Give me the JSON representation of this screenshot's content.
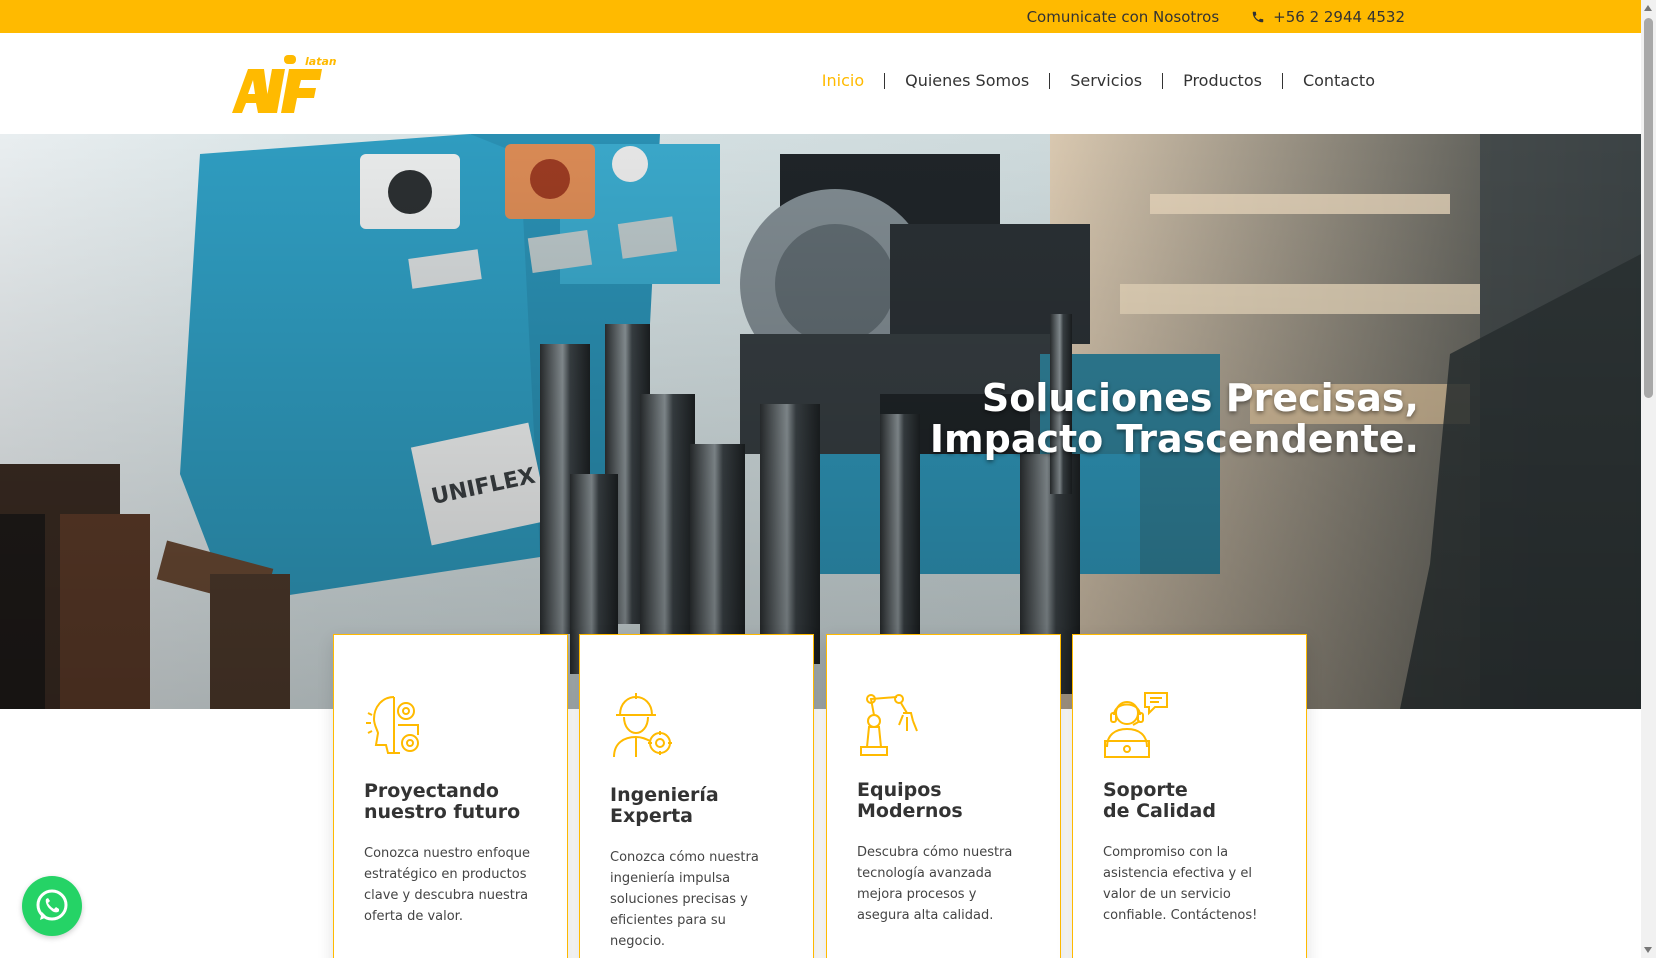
{
  "topbar": {
    "contact_text": "Comunicate con Nosotros",
    "phone": "+56 2 2944 4532",
    "phone_icon": "phone-icon",
    "background": "#ffba00"
  },
  "logo": {
    "text": "AIF",
    "suffix": "latam",
    "color": "#ffba00"
  },
  "nav": {
    "items": [
      {
        "label": "Inicio",
        "active": true
      },
      {
        "label": "Quienes Somos",
        "active": false
      },
      {
        "label": "Servicios",
        "active": false
      },
      {
        "label": "Productos",
        "active": false
      },
      {
        "label": "Contacto",
        "active": false
      }
    ],
    "active_color": "#ffba00"
  },
  "hero": {
    "title_line1": "Soluciones Precisas,",
    "title_line2": "Impacto Trascendente."
  },
  "cards": [
    {
      "icon": "strategy-head-gears-icon",
      "title_line1": "Proyectando",
      "title_line2": "nuestro futuro",
      "text": "Conozca nuestro enfoque estratégico en productos clave y descubra nuestra oferta de valor."
    },
    {
      "icon": "engineer-helmet-gear-icon",
      "title_line1": "Ingeniería",
      "title_line2": "Experta",
      "text": "Conozca cómo nuestra ingeniería impulsa soluciones precisas y eficientes para su negocio."
    },
    {
      "icon": "robotic-arm-icon",
      "title_line1": "Equipos",
      "title_line2": "Modernos",
      "text": "Descubra cómo nuestra tecnología avanzada mejora procesos y asegura alta calidad."
    },
    {
      "icon": "support-agent-headset-icon",
      "title_line1": "Soporte",
      "title_line2": "de Calidad",
      "text": "Compromiso con la asistencia efectiva y el valor de un servicio confiable. Contáctenos!"
    }
  ],
  "whatsapp": {
    "icon": "whatsapp-icon",
    "color": "#25d366"
  }
}
